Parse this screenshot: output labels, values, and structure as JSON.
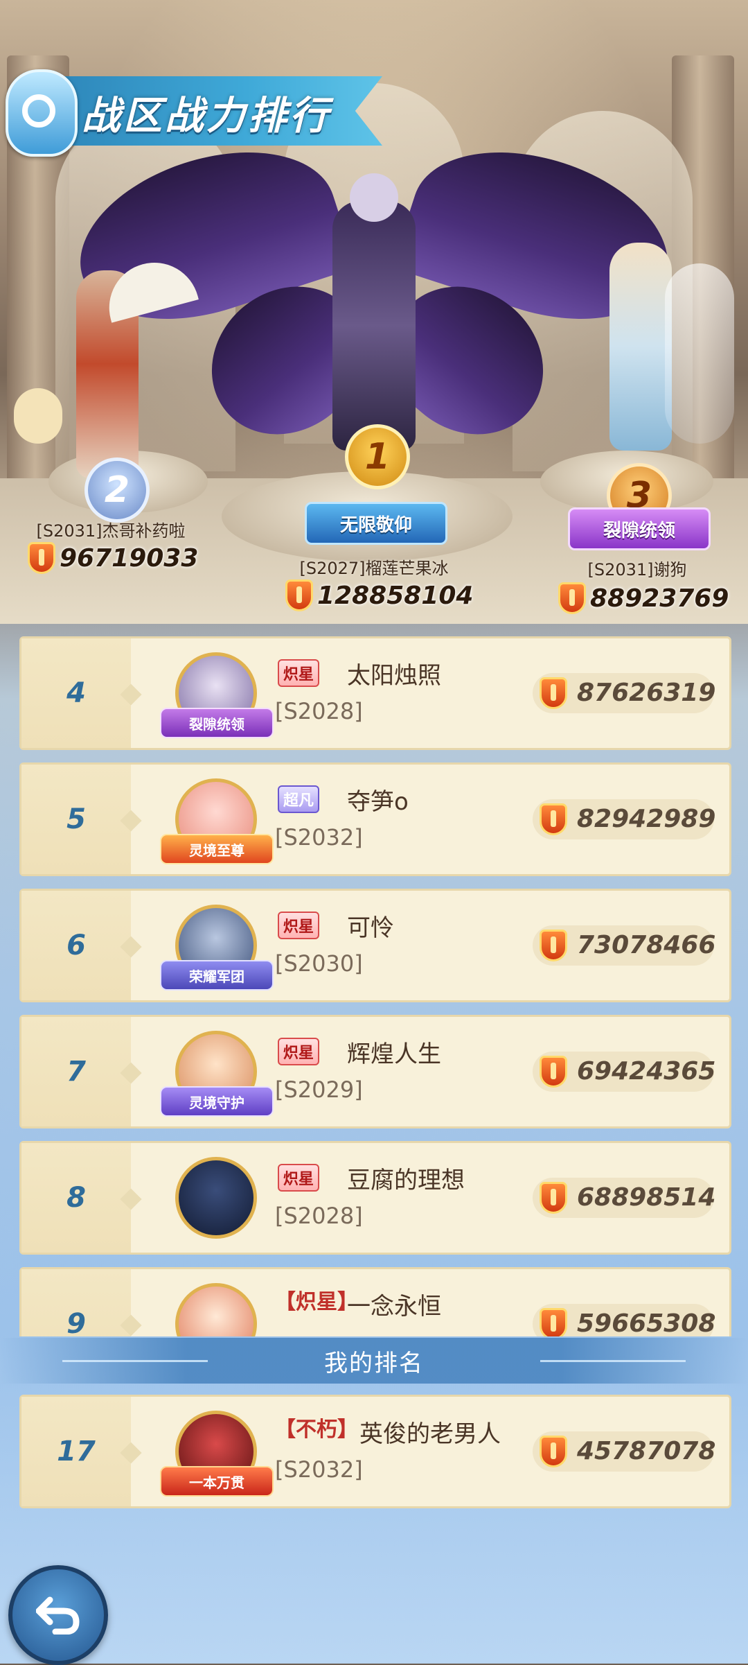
{
  "header": {
    "title": "战区战力排行"
  },
  "podium": [
    {
      "rank": "1",
      "server_name": "[S2027]榴莲芒果冰",
      "power": "128858104",
      "title_plaque": "无限敬仰"
    },
    {
      "rank": "2",
      "server_name": "[S2031]杰哥补药啦",
      "power": "96719033"
    },
    {
      "rank": "3",
      "server_name": "[S2031]谢狗",
      "power": "88923769",
      "title_plaque": "裂隙统领"
    }
  ],
  "rows": [
    {
      "rank": "4",
      "tag": "炽星",
      "name": "太阳烛照",
      "server": "[S2028]",
      "power": "87626319",
      "badge": "裂隙统领"
    },
    {
      "rank": "5",
      "tag": "超凡",
      "name": "夺笋o",
      "server": "[S2032]",
      "power": "82942989",
      "badge": "灵境至尊"
    },
    {
      "rank": "6",
      "tag": "炽星",
      "name": "可怜",
      "server": "[S2030]",
      "power": "73078466",
      "badge": "荣耀军团"
    },
    {
      "rank": "7",
      "tag": "炽星",
      "name": "辉煌人生",
      "server": "[S2029]",
      "power": "69424365",
      "badge": "灵境守护"
    },
    {
      "rank": "8",
      "tag": "炽星",
      "name": "豆腐的理想",
      "server": "[S2028]",
      "power": "68898514",
      "badge": ""
    },
    {
      "rank": "9",
      "tag": "【炽星】",
      "name": "一念永恒",
      "server": "",
      "power": "59665308",
      "badge": ""
    }
  ],
  "my_ranking": {
    "header": "我的排名",
    "rank": "17",
    "tag": "【不朽】",
    "name": "英俊的老男人",
    "server": "[S2032]",
    "power": "45787078",
    "badge": "一本万贯"
  },
  "colors": {
    "rank_text": "#2f6c9a",
    "row_bg": "#f8f1da",
    "accent_blue": "#3fa9d8"
  },
  "icons": {
    "power": "shield-icon",
    "back": "back-arrow-icon"
  }
}
